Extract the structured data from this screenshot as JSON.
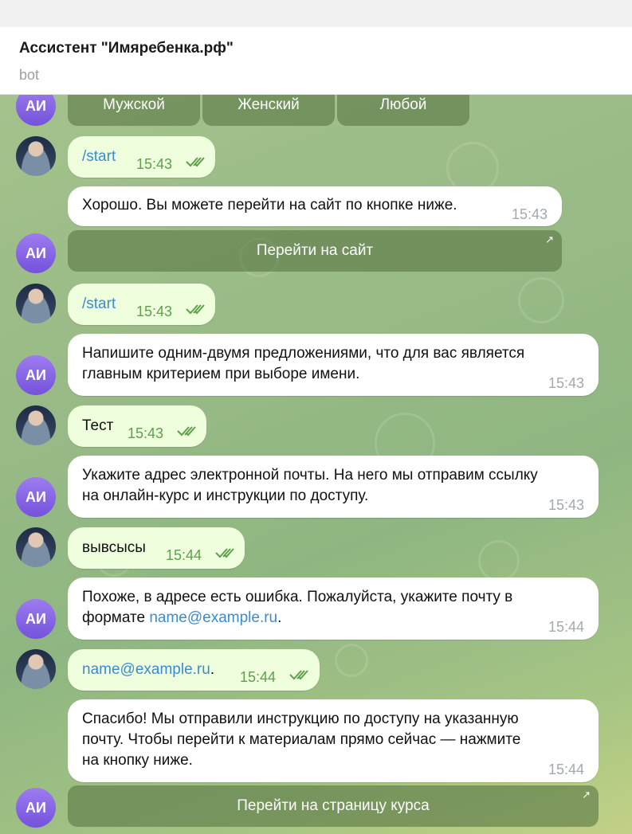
{
  "header": {
    "title": "Ассистент \"Имяребенка.рф\"",
    "subtitle": "bot"
  },
  "avatars": {
    "bot_initials": "АИ"
  },
  "gender_keyboard": [
    "Мужской",
    "Женский",
    "Любой"
  ],
  "messages": [
    {
      "text": "/start",
      "time": "15:43"
    },
    {
      "text": "Хорошо. Вы можете перейти на сайт по кнопке ниже.",
      "time": "15:43",
      "button": "Перейти на сайт"
    },
    {
      "text": "/start",
      "time": "15:43"
    },
    {
      "text": "Напишите одним-двумя предложениями, что для вас является\nглавным критерием при выборе имени.",
      "time": "15:43"
    },
    {
      "text": "Тест",
      "time": "15:43"
    },
    {
      "text": "Укажите адрес электронной почты. На него мы отправим ссылку\nна онлайн-курс и инструкции по доступу.",
      "time": "15:43"
    },
    {
      "text": "вывсысы",
      "time": "15:44"
    },
    {
      "text_before": "Похоже, в адресе есть ошибка. Пожалуйста, укажите почту в\nформате ",
      "link": "name@example.ru",
      "text_after": ".",
      "time": "15:44"
    },
    {
      "link": "name@example.ru",
      "text_after": ".",
      "time": "15:44"
    },
    {
      "text": "Спасибо! Мы отправили инструкцию по доступу на указанную\nпочту. Чтобы перейти к материалам прямо сейчас — нажмите\nна кнопку ниже.",
      "time": "15:44",
      "button": "Перейти на страницу курса"
    }
  ],
  "colors": {
    "bot_avatar": "#8b6ae8",
    "out_bubble": "#effedd",
    "in_bubble": "#ffffff",
    "link": "#3a8bd0",
    "time_out": "#5ea04c"
  }
}
